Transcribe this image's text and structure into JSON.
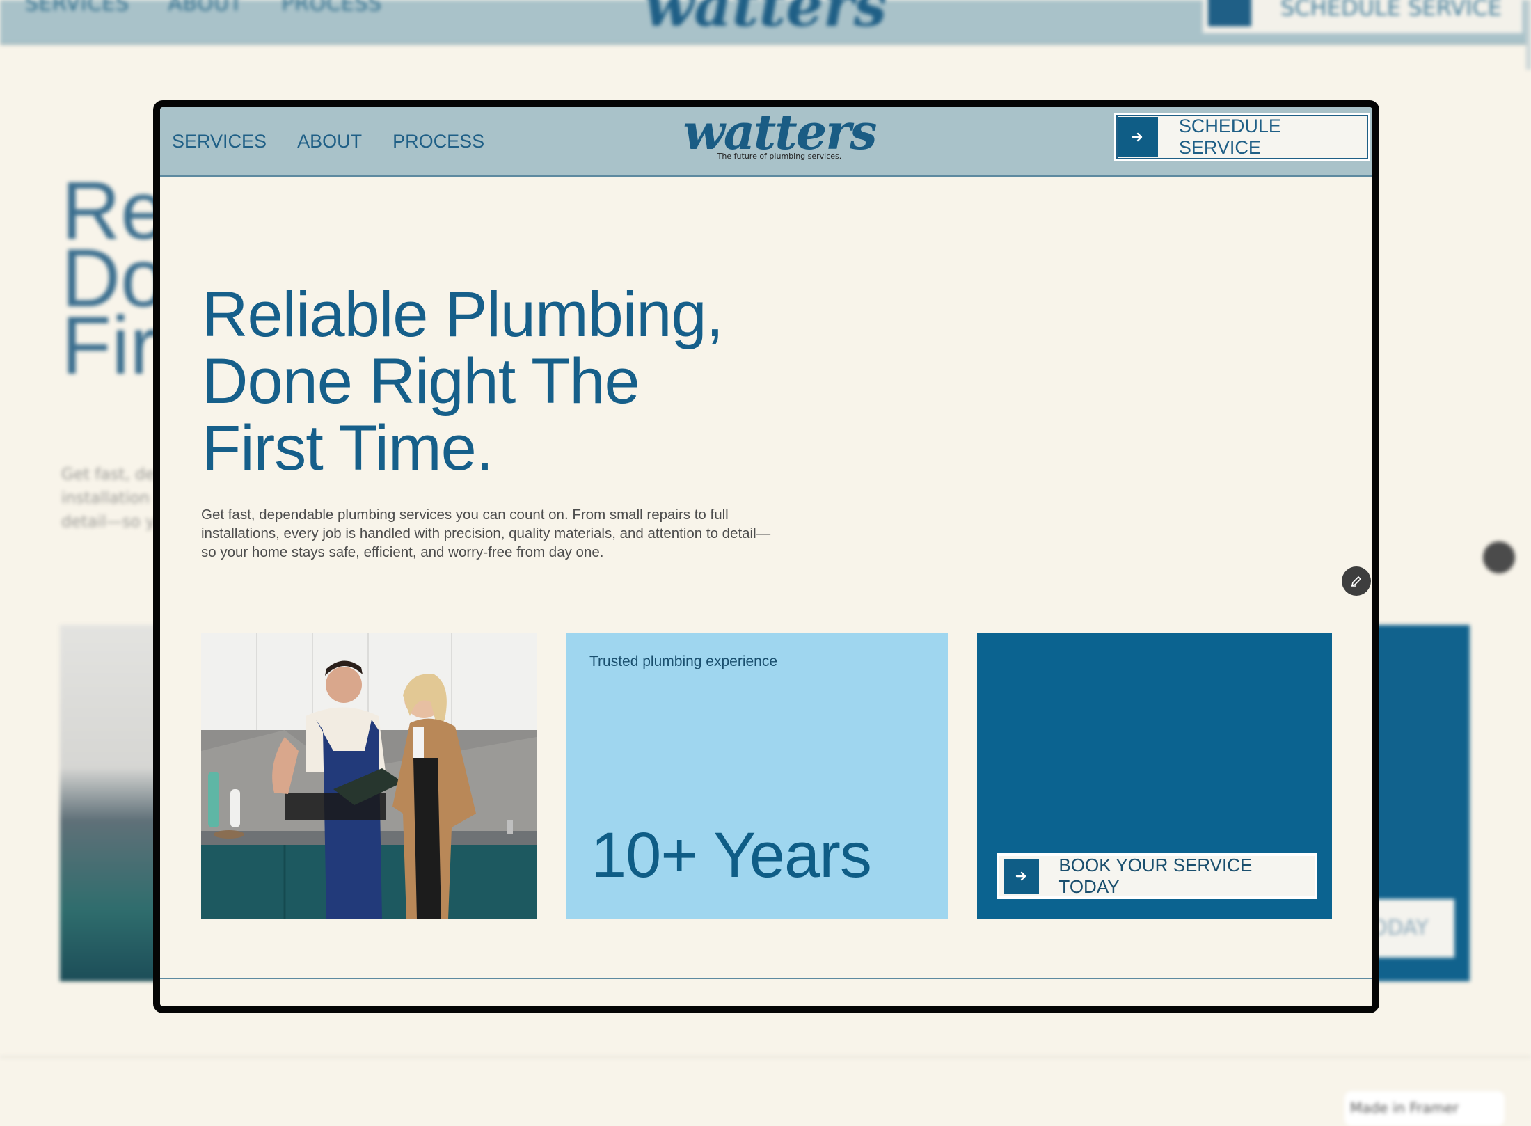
{
  "nav": {
    "items": [
      {
        "label": "SERVICES"
      },
      {
        "label": "ABOUT"
      },
      {
        "label": "PROCESS"
      }
    ]
  },
  "brand": {
    "logo_text": "watters",
    "tagline": "The future of plumbing services."
  },
  "header_cta": {
    "label": "SCHEDULE SERVICE",
    "icon": "arrow-right-icon"
  },
  "hero": {
    "title_lines": [
      "Reliable Plumbing,",
      "Done Right The",
      "First Time."
    ],
    "description": "Get fast, dependable plumbing services you can count on. From small repairs to full installations, every job is handled with precision, quality materials, and attention to detail—so your home stays safe, efficient, and worry-free from day one."
  },
  "experience_card": {
    "label": "Trusted plumbing experience",
    "value": "10+ Years"
  },
  "book_card": {
    "cta_label": "BOOK YOUR SERVICE TODAY",
    "icon": "arrow-right-icon"
  },
  "edit_button": {
    "icon": "pencil-icon"
  },
  "backdrop": {
    "badge_text": "Made in Framer",
    "book_fragment": "ODAY",
    "hero_fragments": [
      "Re",
      "Do",
      "Fir"
    ]
  },
  "colors": {
    "brand_blue": "#0f5d86",
    "header_bg": "#a9c2c9",
    "page_bg": "#f8f4ea",
    "light_blue": "#9fd6ef"
  }
}
